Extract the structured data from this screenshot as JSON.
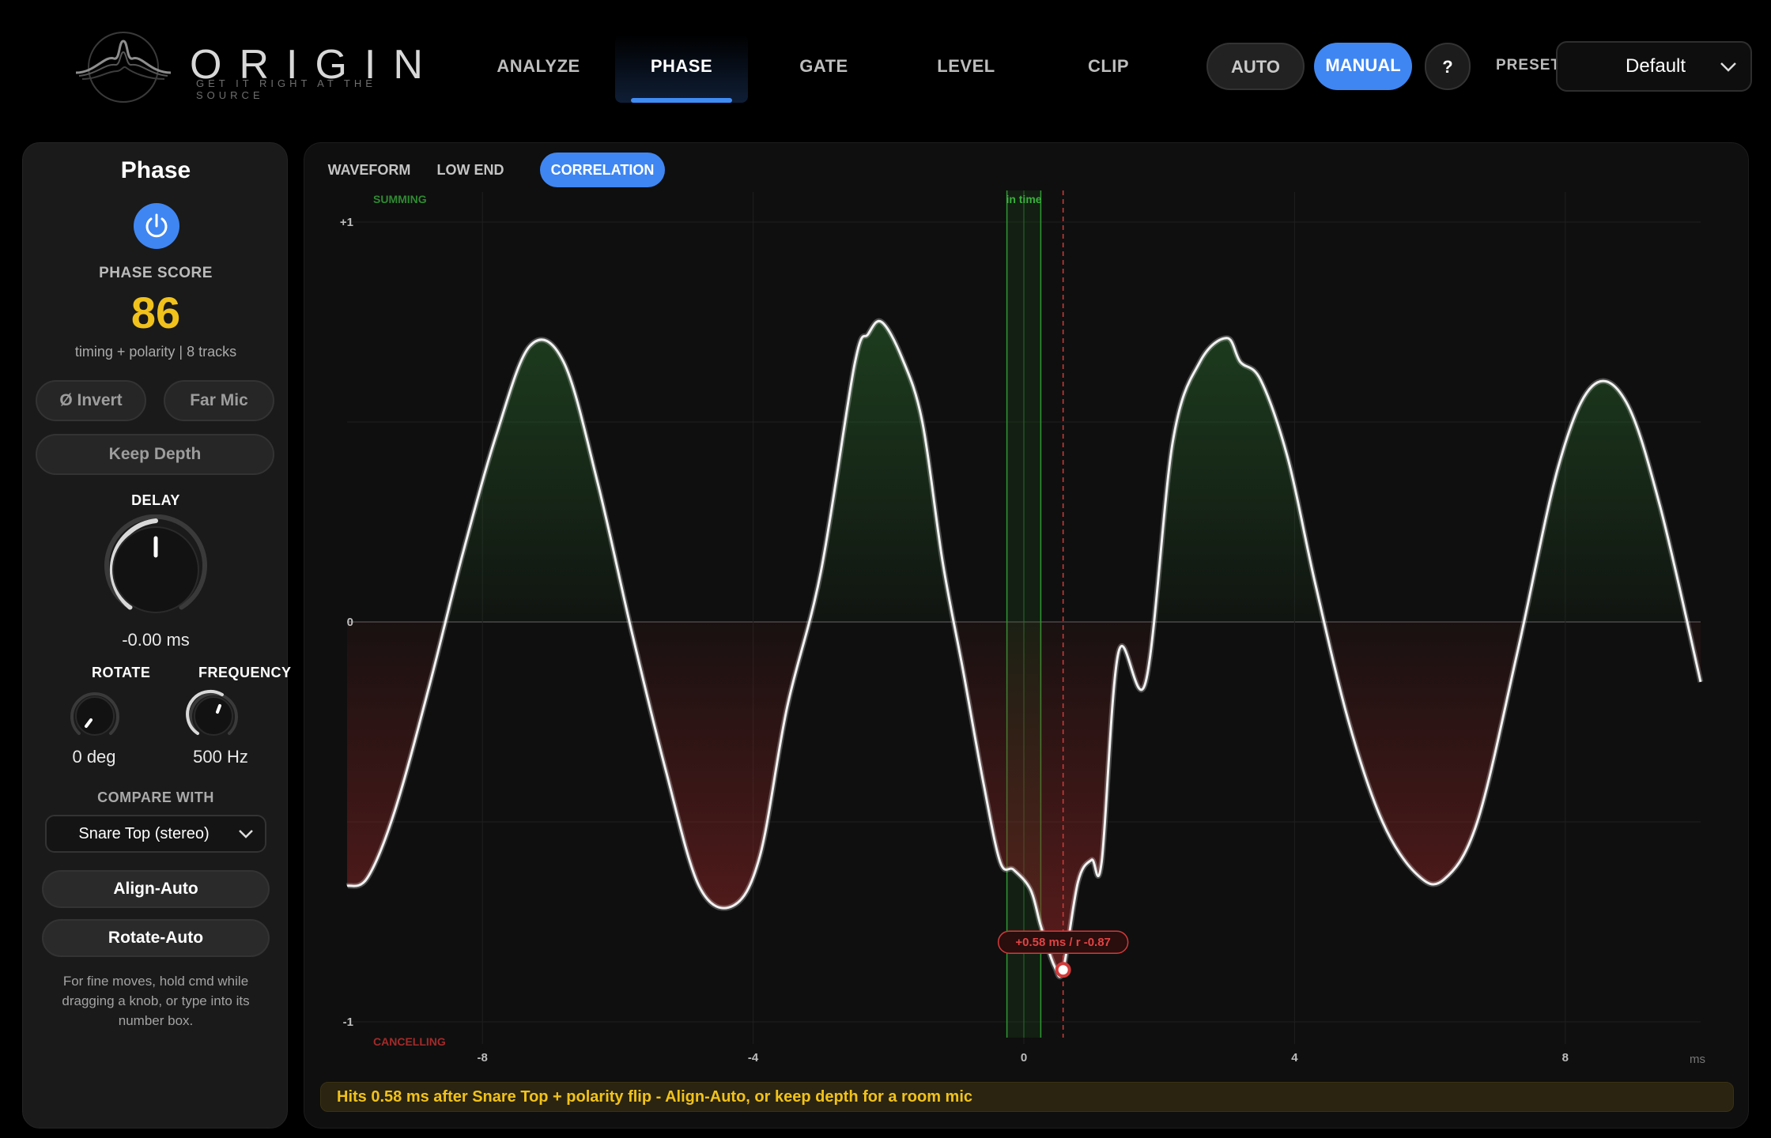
{
  "app": {
    "logo_text": "ORIGIN",
    "tagline": "GET IT RIGHT AT THE SOURCE"
  },
  "nav": {
    "tabs": [
      {
        "label": "ANALYZE",
        "active": false
      },
      {
        "label": "PHASE",
        "active": true
      },
      {
        "label": "GATE",
        "active": false
      },
      {
        "label": "LEVEL",
        "active": false
      },
      {
        "label": "CLIP",
        "active": false
      }
    ],
    "auto_label": "AUTO",
    "manual_label": "MANUAL",
    "help_label": "?",
    "preset_label": "PRESET",
    "preset_value": "Default",
    "accent": "#3f86f2"
  },
  "phase_panel": {
    "title": "Phase",
    "power_on": true,
    "score_label": "PHASE SCORE",
    "score_value": "86",
    "score_color": "#f1c21b",
    "score_sub": "timing + polarity  |  8 tracks",
    "invert_label": "Ø Invert",
    "far_mic_label": "Far Mic",
    "keep_depth_label": "Keep Depth",
    "delay_label": "DELAY",
    "delay_value": "-0.00 ms",
    "rotate_label": "ROTATE",
    "rotate_value": "0 deg",
    "frequency_label": "FREQUENCY",
    "frequency_value": "500 Hz",
    "compare_label": "COMPARE WITH",
    "compare_value": "Snare Top  (stereo)",
    "align_auto_label": "Align-Auto",
    "rotate_auto_label": "Rotate-Auto",
    "hint": "For fine moves, hold cmd while dragging a knob, or type into its number box."
  },
  "view_tabs": [
    {
      "label": "WAVEFORM",
      "active": false
    },
    {
      "label": "LOW END",
      "active": false
    },
    {
      "label": "CORRELATION",
      "active": true
    }
  ],
  "chart_data": {
    "type": "line",
    "title": "",
    "xlabel": "ms",
    "ylabel": "",
    "xlim": [
      -10,
      10
    ],
    "ylim": [
      -1,
      1
    ],
    "x_ticks": [
      -8,
      -4,
      0,
      4,
      8
    ],
    "y_ticks": [
      {
        "value": 1,
        "label": "+1"
      },
      {
        "value": 0,
        "label": "0"
      },
      {
        "value": -1,
        "label": "-1"
      }
    ],
    "top_zone_label": "SUMMING",
    "bottom_zone_label": "CANCELLING",
    "in_time_label": "in time",
    "in_time_range": [
      -0.25,
      0.25
    ],
    "positive_color": "#2f7a32",
    "negative_color": "#8a2424",
    "series": [
      {
        "x": [
          -10,
          -9.7,
          -9.3,
          -8.8,
          -8.3,
          -7.8,
          -7.3,
          -6.8,
          -6.3,
          -5.8,
          -5.3,
          -4.8,
          -4.3,
          -3.9,
          -3.5,
          -3.0,
          -2.5,
          -2.3,
          -2.1,
          -1.8,
          -1.5,
          -1.2,
          -0.9,
          -0.6,
          -0.35,
          -0.15,
          0.1,
          0.25,
          0.45,
          0.58,
          0.8,
          1.0,
          1.15,
          1.4,
          1.8,
          2.2,
          2.6,
          3.0,
          3.2,
          3.5,
          3.9,
          4.3,
          4.8,
          5.3,
          5.8,
          6.2,
          6.7,
          7.3,
          7.9,
          8.4,
          8.9,
          9.4,
          10.0
        ],
        "y": [
          -1.32,
          -1.28,
          -0.95,
          -0.34,
          0.33,
          0.93,
          1.38,
          1.3,
          0.7,
          -0.04,
          -0.73,
          -1.32,
          -1.42,
          -1.17,
          -0.43,
          0.25,
          1.29,
          1.44,
          1.5,
          1.32,
          1.0,
          0.3,
          -0.24,
          -0.8,
          -1.2,
          -1.24,
          -1.34,
          -1.52,
          -1.72,
          -1.74,
          -1.3,
          -1.19,
          -1.2,
          -0.15,
          -0.3,
          0.9,
          1.3,
          1.42,
          1.3,
          1.21,
          0.82,
          0.2,
          -0.5,
          -1.0,
          -1.26,
          -1.29,
          -1.0,
          -0.14,
          0.78,
          1.18,
          1.1,
          0.58,
          -0.3
        ]
      }
    ],
    "marker": {
      "x": 0.58,
      "y": -1.74,
      "label": "+0.58 ms / r -0.87"
    }
  },
  "status_message": "Hits 0.58 ms after Snare Top + polarity flip - Align-Auto, or keep depth for a room mic"
}
